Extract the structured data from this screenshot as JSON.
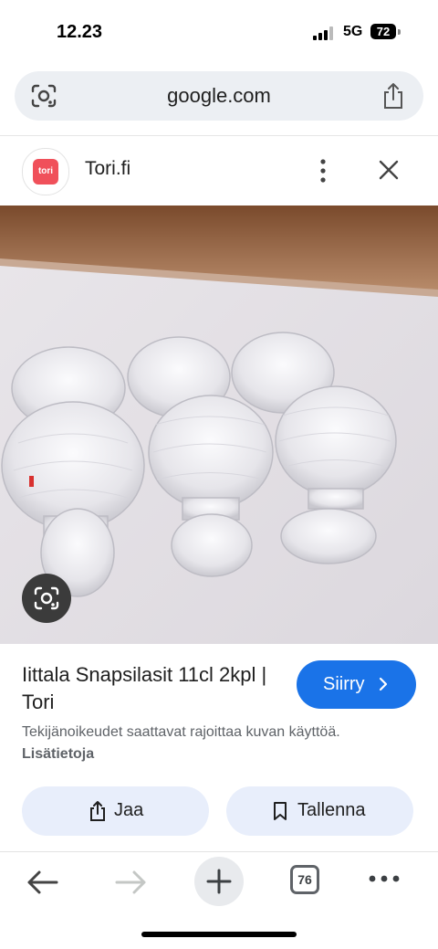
{
  "status": {
    "time": "12.23",
    "network": "5G",
    "battery": "72"
  },
  "url_bar": {
    "url": "google.com"
  },
  "site": {
    "logo_text": "tori",
    "name": "Tori.fi"
  },
  "result": {
    "title": "Iittala Snapsilasit 11cl 2kpl | Tori",
    "visit_label": "Siirry",
    "notice": "Tekijänoikeudet saattavat rajoittaa kuvan käyttöä.",
    "notice_link": "Lisätietoja"
  },
  "actions": {
    "share_label": "Jaa",
    "save_label": "Tallenna"
  },
  "toolbar": {
    "tab_count": "76"
  },
  "icons": [
    "lens-icon",
    "share-icon",
    "more-vert-icon",
    "close-icon",
    "chevron-right-icon",
    "bookmark-icon",
    "back-arrow-icon",
    "forward-arrow-icon",
    "plus-icon",
    "tabs-icon",
    "more-horiz-icon"
  ],
  "colors": {
    "accent": "#1a73e8",
    "pill_bg": "#e8eefb",
    "url_bar_bg": "#eceff3",
    "logo": "#f0505a"
  }
}
